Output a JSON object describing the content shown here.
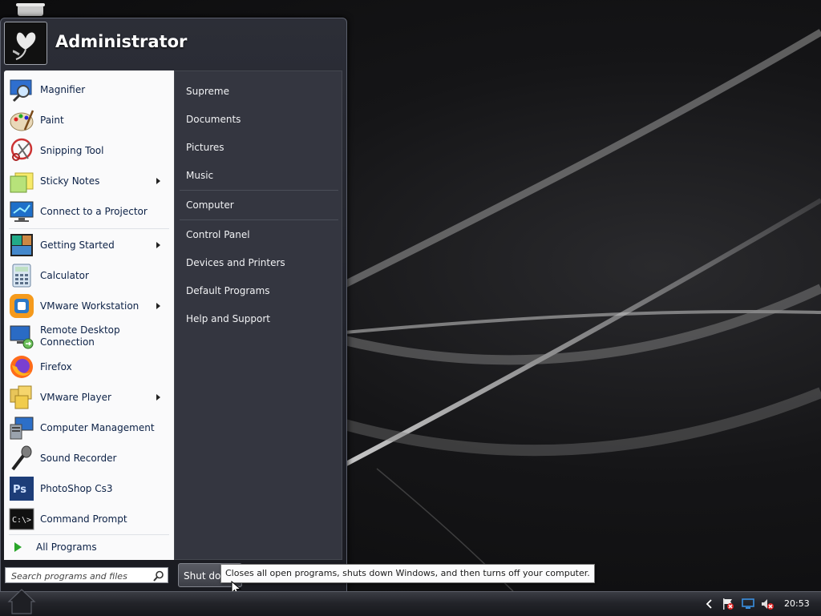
{
  "user": {
    "name": "Administrator"
  },
  "programs": [
    {
      "label": "Magnifier",
      "icon": "magnifier-icon",
      "submenu": false
    },
    {
      "label": "Paint",
      "icon": "paint-palette-icon",
      "submenu": false
    },
    {
      "label": "Snipping Tool",
      "icon": "scissors-icon",
      "submenu": false
    },
    {
      "label": "Sticky Notes",
      "icon": "sticky-note-icon",
      "submenu": true
    },
    {
      "label": "Connect to a Projector",
      "icon": "projector-monitor-icon",
      "submenu": false
    },
    {
      "label": "Getting Started",
      "icon": "getting-started-icon",
      "submenu": true
    },
    {
      "label": "Calculator",
      "icon": "calculator-icon",
      "submenu": false
    },
    {
      "label": "VMware Workstation",
      "icon": "vmware-workstation-icon",
      "submenu": true
    },
    {
      "label": "Remote Desktop Connection",
      "icon": "remote-desktop-icon",
      "submenu": false
    },
    {
      "label": "Firefox",
      "icon": "firefox-icon",
      "submenu": false
    },
    {
      "label": "VMware Player",
      "icon": "vmware-player-icon",
      "submenu": true
    },
    {
      "label": "Computer Management",
      "icon": "computer-management-icon",
      "submenu": false
    },
    {
      "label": "Sound Recorder",
      "icon": "microphone-icon",
      "submenu": false
    },
    {
      "label": "PhotoShop Cs3",
      "icon": "photoshop-icon",
      "submenu": false
    },
    {
      "label": "Command Prompt",
      "icon": "command-prompt-icon",
      "submenu": false
    }
  ],
  "all_programs_label": "All Programs",
  "places": [
    {
      "label": "Supreme"
    },
    {
      "label": "Documents"
    },
    {
      "label": "Pictures"
    },
    {
      "label": "Music"
    },
    {
      "label": "Computer"
    },
    {
      "label": "Control Panel"
    },
    {
      "label": "Devices and Printers"
    },
    {
      "label": "Default Programs"
    },
    {
      "label": "Help and Support"
    }
  ],
  "search": {
    "placeholder": "Search programs and files",
    "value": ""
  },
  "shutdown": {
    "label": "Shut dow",
    "tooltip": "Closes all open programs, shuts down Windows, and then turns off your computer."
  },
  "taskbar": {
    "clock": "20:53"
  },
  "colors": {
    "accent": "#2aa62a",
    "menu_bg": "#2c2e37",
    "left_pane": "#fafafb"
  }
}
